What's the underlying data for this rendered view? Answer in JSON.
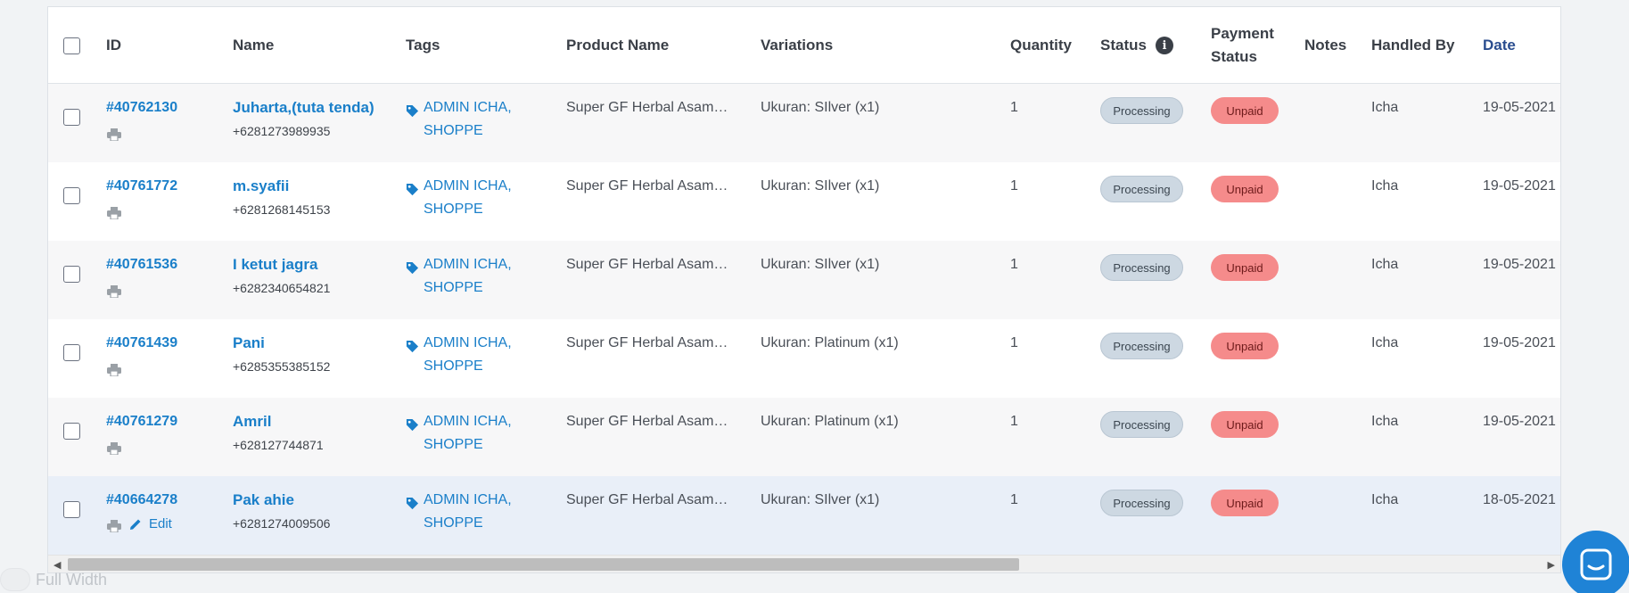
{
  "header": {
    "id": "ID",
    "name": "Name",
    "tags": "Tags",
    "product_name": "Product Name",
    "variations": "Variations",
    "quantity": "Quantity",
    "status": "Status",
    "payment_status_1": "Payment",
    "payment_status_2": "Status",
    "notes": "Notes",
    "handled_by": "Handled By",
    "date": "Date"
  },
  "rows": [
    {
      "id": "#40762130",
      "name": "Juharta,(tuta tenda)",
      "phone": "+6281273989935",
      "tag1": "ADMIN ICHA,",
      "tag2": "SHOPPE",
      "product": "Super GF Herbal Asam…",
      "variation": "Ukuran: SIlver (x1)",
      "qty": "1",
      "status": "Processing",
      "payment": "Unpaid",
      "handler": "Icha",
      "date": "19-05-2021 -"
    },
    {
      "id": "#40761772",
      "name": "m.syafii",
      "phone": "+6281268145153",
      "tag1": "ADMIN ICHA,",
      "tag2": "SHOPPE",
      "product": "Super GF Herbal Asam…",
      "variation": "Ukuran: SIlver (x1)",
      "qty": "1",
      "status": "Processing",
      "payment": "Unpaid",
      "handler": "Icha",
      "date": "19-05-2021 -"
    },
    {
      "id": "#40761536",
      "name": "I ketut jagra",
      "phone": "+6282340654821",
      "tag1": "ADMIN ICHA,",
      "tag2": "SHOPPE",
      "product": "Super GF Herbal Asam…",
      "variation": "Ukuran: SIlver (x1)",
      "qty": "1",
      "status": "Processing",
      "payment": "Unpaid",
      "handler": "Icha",
      "date": "19-05-2021 -"
    },
    {
      "id": "#40761439",
      "name": "Pani",
      "phone": "+6285355385152",
      "tag1": "ADMIN ICHA,",
      "tag2": "SHOPPE",
      "product": "Super GF Herbal Asam…",
      "variation": "Ukuran: Platinum (x1)",
      "qty": "1",
      "status": "Processing",
      "payment": "Unpaid",
      "handler": "Icha",
      "date": "19-05-2021 -"
    },
    {
      "id": "#40761279",
      "name": "Amril",
      "phone": "+628127744871",
      "tag1": "ADMIN ICHA,",
      "tag2": "SHOPPE",
      "product": "Super GF Herbal Asam…",
      "variation": "Ukuran: Platinum (x1)",
      "qty": "1",
      "status": "Processing",
      "payment": "Unpaid",
      "handler": "Icha",
      "date": "19-05-2021 -"
    },
    {
      "id": "#40664278",
      "name": "Pak ahie",
      "phone": "+6281274009506",
      "tag1": "ADMIN ICHA,",
      "tag2": "SHOPPE",
      "product": "Super GF Herbal Asam…",
      "variation": "Ukuran: SIlver (x1)",
      "qty": "1",
      "status": "Processing",
      "payment": "Unpaid",
      "handler": "Icha",
      "date": "18-05-2021 -",
      "edit": "Edit"
    }
  ],
  "footer": {
    "full_width_label": "Full Width"
  },
  "colors": {
    "link": "#1a7fc9",
    "processing_badge": "#cdd8e2",
    "unpaid_badge": "#f58b8b",
    "chat_button": "#1f83d6"
  }
}
